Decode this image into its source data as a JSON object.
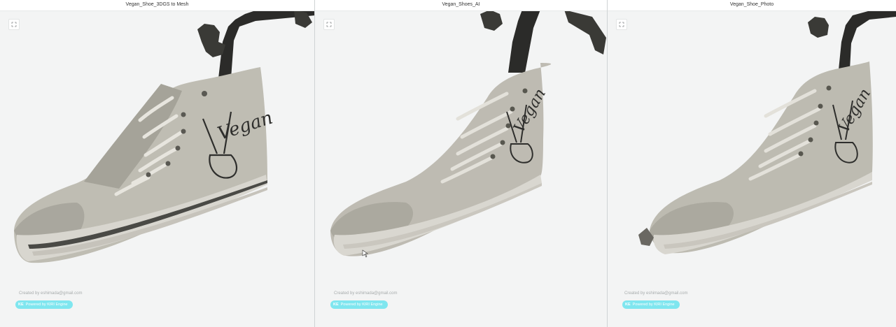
{
  "panels": [
    {
      "title": "Vegan_Shoe_3DGS to Mesh",
      "credit": "Created by eshimada@gmail.com",
      "powered": "Powered by KIRI Engine",
      "powered_logo": "KE"
    },
    {
      "title": "Vegan_Shoes_AI",
      "credit": "Created by eshimada@gmail.com",
      "powered": "Powered by KIRI Engine",
      "powered_logo": "KE"
    },
    {
      "title": "Vegan_Shoe_Photo",
      "credit": "Created by eshimada@gmail.com",
      "powered": "Powered by KIRI Engine",
      "powered_logo": "KE"
    }
  ],
  "shoe_print": "Vegan",
  "icons": {
    "fullscreen": "expand-icon",
    "cursor": "pointer-cursor-icon"
  },
  "colors": {
    "viewer_bg": "#f3f4f4",
    "powered_badge": "#7fe6ef",
    "canvas": "#c9c7bd",
    "stand": "#2a2a28"
  }
}
